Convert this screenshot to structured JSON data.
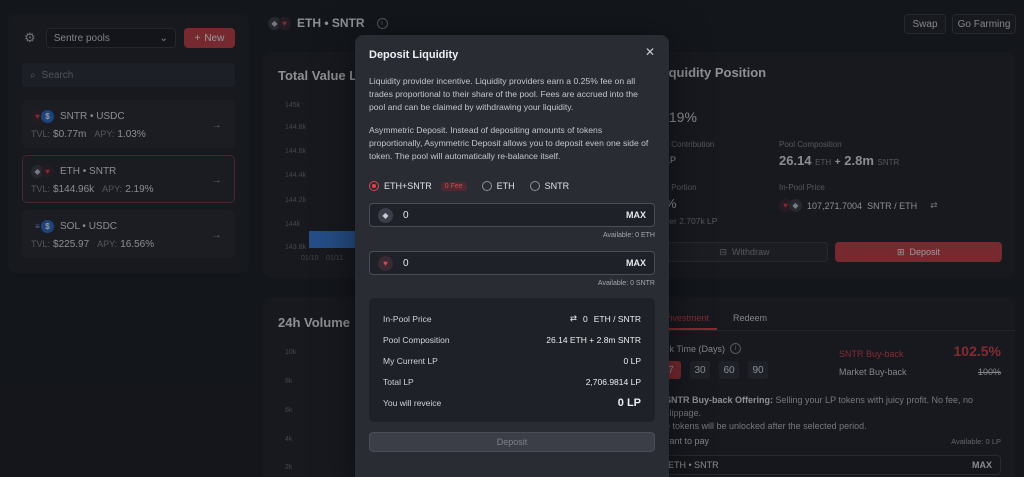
{
  "sidebar": {
    "pool_filter": "Sentre pools",
    "new_label": "New",
    "search_placeholder": "Search",
    "pools": [
      {
        "pair": "SNTR • USDC",
        "tvl_label": "TVL:",
        "tvl": "$0.77m",
        "apy_label": "APY:",
        "apy": "1.03%"
      },
      {
        "pair": "ETH • SNTR",
        "tvl_label": "TVL:",
        "tvl": "$144.96k",
        "apy_label": "APY:",
        "apy": "2.19%"
      },
      {
        "pair": "SOL • USDC",
        "tvl_label": "TVL:",
        "tvl": "$225.97",
        "apy_label": "APY:",
        "apy": "16.56%"
      }
    ]
  },
  "header": {
    "pair_title": "ETH • SNTR",
    "swap_label": "Swap",
    "farming_label": "Go Farming"
  },
  "tvl_panel": {
    "title": "Total Value Lo",
    "y_ticks": [
      "145k",
      "144.8k",
      "144.6k",
      "144.4k",
      "144.2k",
      "144k",
      "143.8k"
    ],
    "x_ticks": [
      "01/10",
      "01/11"
    ]
  },
  "lp_panel": {
    "title": "iquidity Position",
    "apy_label": "y",
    "apy_value": ".19%",
    "contribution_label": "y Contribution",
    "contribution_value": "LP",
    "composition_label": "Pool Composition",
    "composition_a": "26.14",
    "composition_a_unit": "ETH",
    "composition_b": "2.8m",
    "composition_b_unit": "SNTR",
    "portion_label": "y Portion",
    "portion_value": "%",
    "portion_sub": "ver 2.707k LP",
    "price_label": "In-Pool Price",
    "price_value": "107,271.7004",
    "price_unit": "SNTR / ETH",
    "withdraw_label": "Withdraw",
    "deposit_label": "Deposit"
  },
  "volume_panel": {
    "title": "24h Volume",
    "y_ticks": [
      "10k",
      "8k",
      "6k",
      "4k",
      "2k"
    ]
  },
  "invest_panel": {
    "tab_active": "Investment",
    "tab_redeem": "Redeem",
    "lock_label": "ck Time (Days)",
    "days": [
      "7",
      "30",
      "60",
      "90"
    ],
    "sntr_buyback_label": "SNTR Buy-back",
    "sntr_buyback_value": "102.5%",
    "market_buyback_label": "Market Buy-back",
    "market_buyback_value": "100%",
    "offering_bold": "SNTR Buy-back Offering:",
    "offering_text": "Selling your LP tokens with juicy profit. No fee, no slippage.",
    "offering_text2": "e tokens will be unlocked after the selected period.",
    "want_label": "vant to pay",
    "available": "Available: 0 LP",
    "pay_token": "ETH • SNTR",
    "max_label": "MAX"
  },
  "modal": {
    "title": "Deposit Liquidity",
    "p1_title": "Liquidity provider incentive.",
    "p1_text": "Liquidity providers earn a 0.25% fee on all trades proportional to their share of the pool. Fees are accrued into the pool and can be claimed by withdrawing your liquidity.",
    "p2_title": "Asymmetric Deposit.",
    "p2_text": "Instead of depositing amounts of tokens proportionally, Asymmetric Deposit allows you to deposit even one side of token. The pool will automatically re-balance itself.",
    "options": [
      {
        "label": "ETH+SNTR",
        "selected": true,
        "badge": "0 Fee"
      },
      {
        "label": "ETH",
        "selected": false
      },
      {
        "label": "SNTR",
        "selected": false
      }
    ],
    "input_eth": {
      "value": "0",
      "max": "MAX",
      "available": "Available: 0 ETH"
    },
    "input_sntr": {
      "value": "0",
      "max": "MAX",
      "available": "Available: 0 SNTR"
    },
    "summary": {
      "price_label": "In-Pool Price",
      "price_value": "0",
      "price_unit": "ETH / SNTR",
      "composition_label": "Pool Composition",
      "composition_value": "26.14 ETH + 2.8m SNTR",
      "current_lp_label": "My Current LP",
      "current_lp_value": "0 LP",
      "total_lp_label": "Total LP",
      "total_lp_value": "2,706.9814 LP",
      "receive_label": "You will reveice",
      "receive_value": "0 LP"
    },
    "deposit_label": "Deposit"
  }
}
